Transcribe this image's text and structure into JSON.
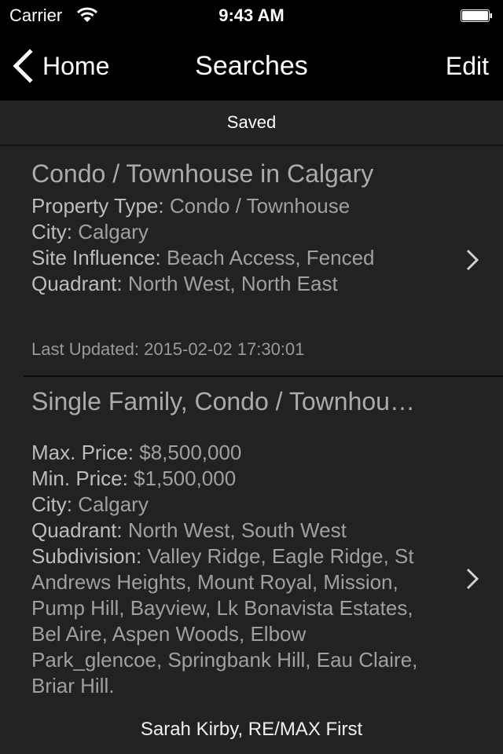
{
  "status_bar": {
    "carrier": "Carrier",
    "time": "9:43 AM"
  },
  "nav": {
    "back_label": "Home",
    "title": "Searches",
    "edit_label": "Edit"
  },
  "section_header": "Saved",
  "searches": [
    {
      "title": "Condo / Townhouse in Calgary",
      "fields": [
        {
          "label": "Property Type:",
          "value": "Condo / Townhouse"
        },
        {
          "label": "City:",
          "value": "Calgary"
        },
        {
          "label": "Site Influence:",
          "value": "Beach Access, Fenced"
        },
        {
          "label": "Quadrant:",
          "value": "North West, North East"
        }
      ],
      "last_updated": "Last Updated: 2015-02-02 17:30:01"
    },
    {
      "title": "Single Family, Condo / Townhou…",
      "fields": [
        {
          "label": "Max. Price:",
          "value": "$8,500,000"
        },
        {
          "label": "Min. Price:",
          "value": "$1,500,000"
        },
        {
          "label": "City:",
          "value": "Calgary"
        },
        {
          "label": "Quadrant:",
          "value": "North West, South West"
        },
        {
          "label": "Subdivision:",
          "value": "Valley Ridge, Eagle Ridge, St Andrews Heights, Mount Royal, Mission, Pump Hill, Bayview, Lk Bonavista Estates, Bel Aire, Aspen Woods, Elbow Park_glencoe, Springbank Hill, Eau Claire, Briar Hill."
        }
      ]
    }
  ],
  "footer": "Sarah Kirby, RE/MAX First"
}
